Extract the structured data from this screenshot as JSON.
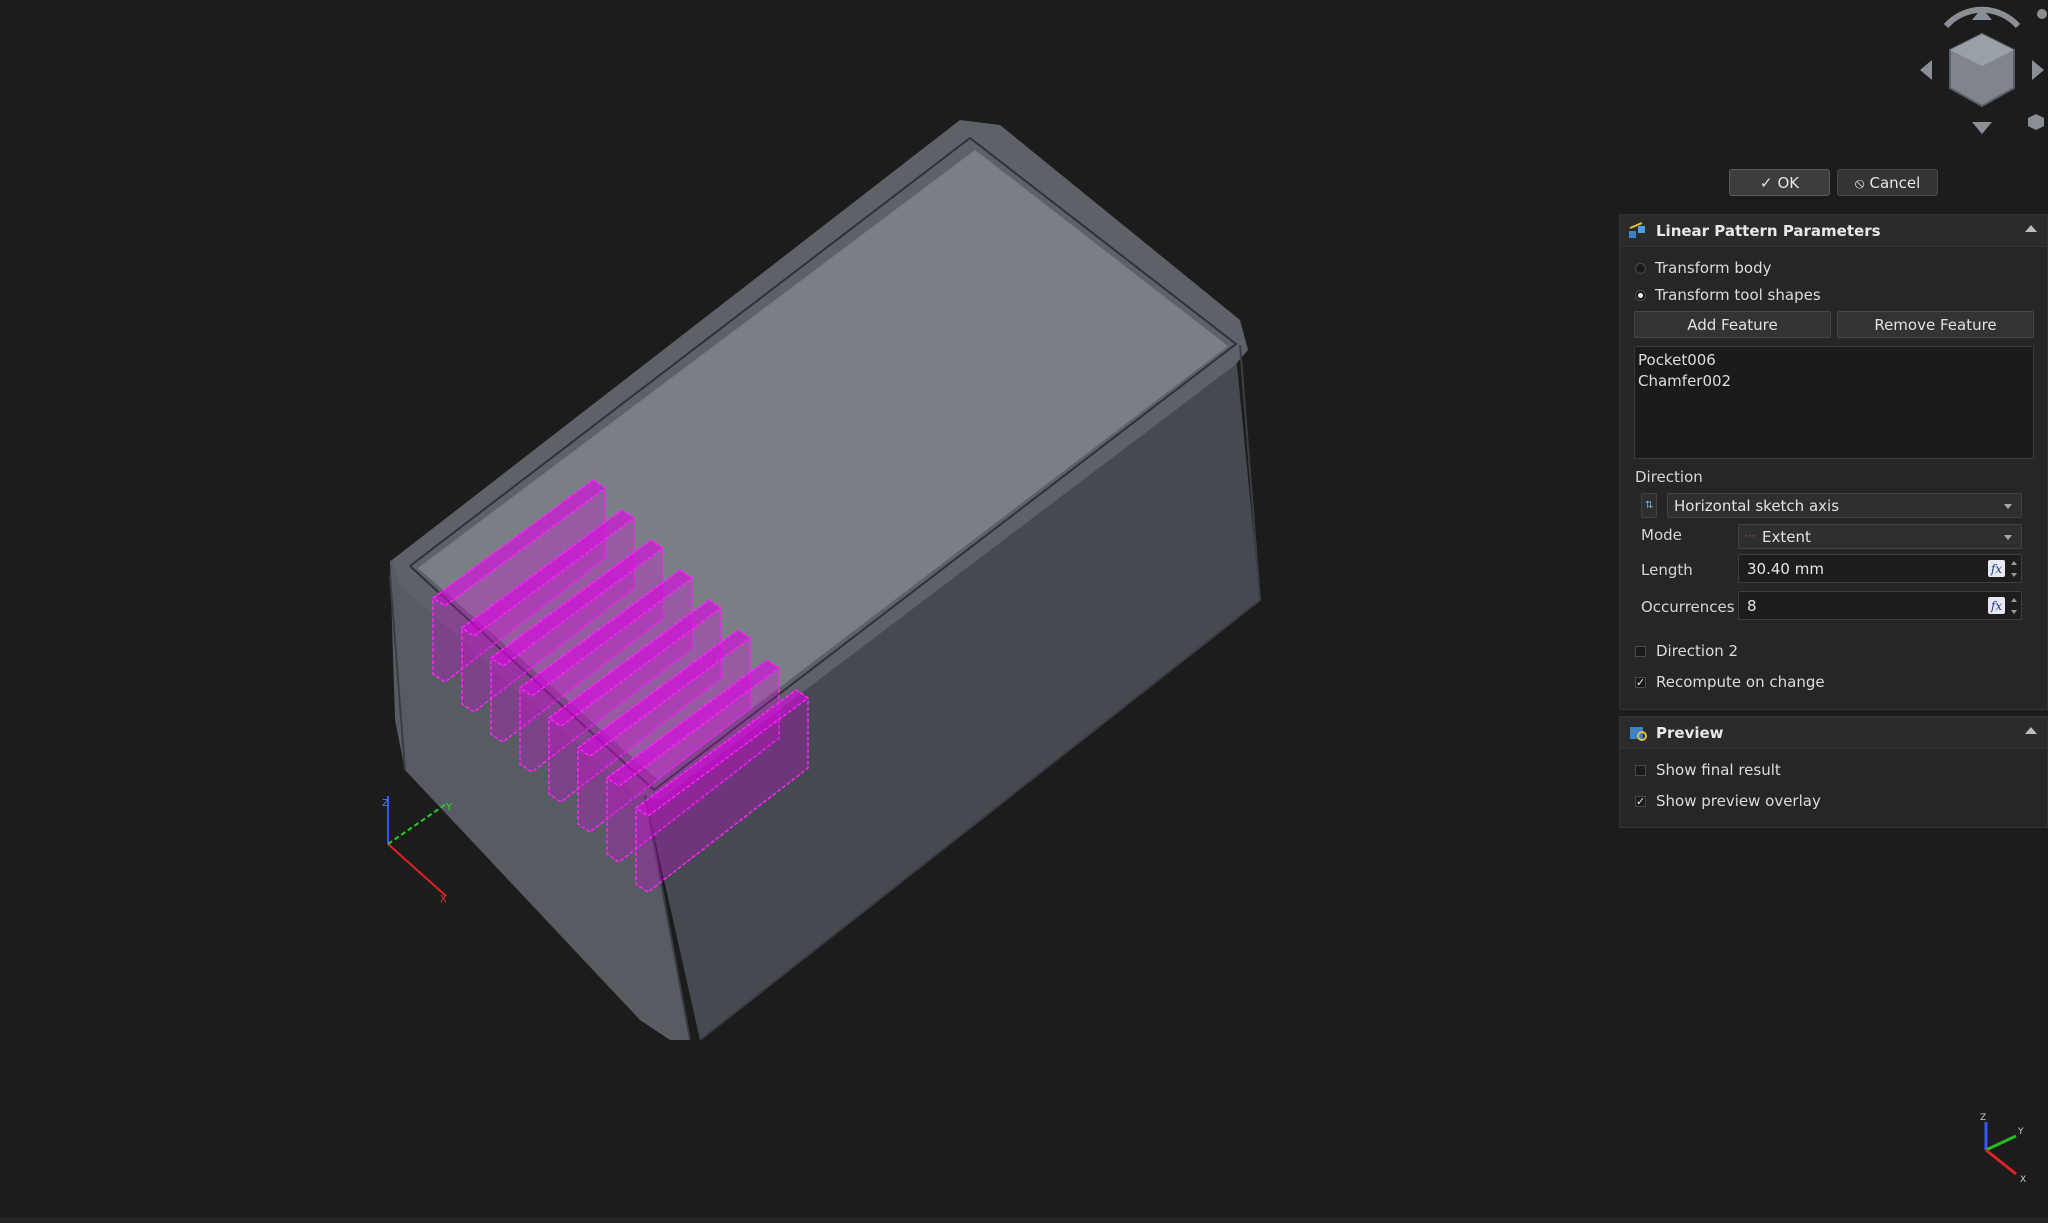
{
  "dialog": {
    "ok_label": "OK",
    "cancel_label": "Cancel"
  },
  "linear_pattern_panel": {
    "title": "Linear Pattern Parameters",
    "transform_body_label": "Transform body",
    "transform_tool_shapes_label": "Transform tool shapes",
    "selected_mode": "Transform tool shapes",
    "add_feature_label": "Add Feature",
    "remove_feature_label": "Remove Feature",
    "features": [
      "Pocket006",
      "Chamfer002"
    ],
    "direction_label": "Direction",
    "direction_value": "Horizontal sketch axis",
    "mode_label": "Mode",
    "mode_value": "Extent",
    "length_label": "Length",
    "length_value": "30.40 mm",
    "occurrences_label": "Occurrences",
    "occurrences_value": "8",
    "direction2_label": "Direction 2",
    "direction2_checked": false,
    "recompute_label": "Recompute on change",
    "recompute_checked": true
  },
  "preview_panel": {
    "title": "Preview",
    "show_final_label": "Show final result",
    "show_final_checked": false,
    "show_overlay_label": "Show preview overlay",
    "show_overlay_checked": true
  },
  "axes": {
    "x": "X",
    "y": "Y",
    "z": "Z"
  },
  "colors": {
    "background": "#1c1c1c",
    "model_top": "#7a7f86",
    "model_side": "#4a4f56",
    "preview_overlay": "#e000e6"
  },
  "icons": {
    "panel": "linear-pattern-icon",
    "preview": "preview-icon",
    "navcube": "navigation-cube-icon"
  }
}
